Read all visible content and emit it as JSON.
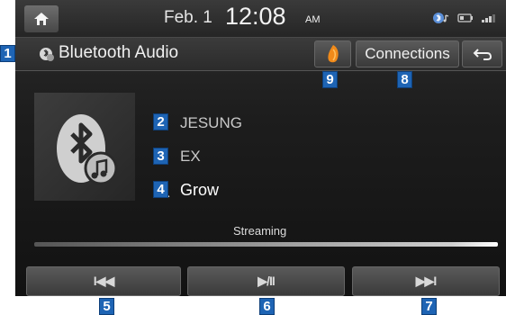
{
  "status_bar": {
    "date": "Feb.  1",
    "time": "12:08",
    "ampm": "AM",
    "icons": [
      "home-icon",
      "bluetooth-audio-icon",
      "battery-icon",
      "signal-icon"
    ]
  },
  "title_bar": {
    "title": "Bluetooth Audio",
    "connections_label": "Connections"
  },
  "track": {
    "device": "JESUNG",
    "artist": "EX",
    "title": "Grow",
    "status": "Streaming",
    "progress": 1.0
  },
  "controls": {
    "prev_label": "I◀◀",
    "play_label": "▶/II",
    "next_label": "▶▶I"
  },
  "callouts": [
    "1",
    "2",
    "3",
    "4",
    "5",
    "6",
    "7",
    "8",
    "9"
  ],
  "colors": {
    "callout": "#1e64b4",
    "background": "#1d1d1d"
  }
}
